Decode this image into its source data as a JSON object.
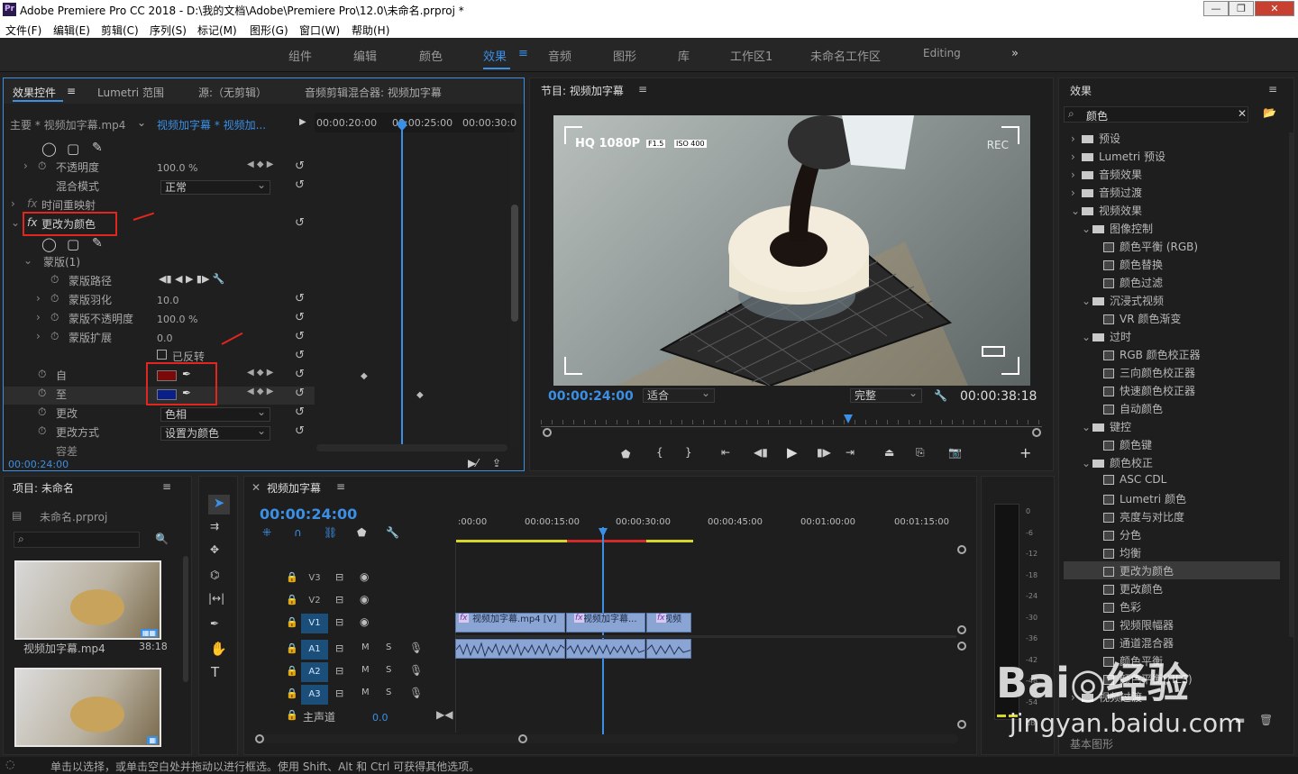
{
  "window": {
    "title": "Adobe Premiere Pro CC 2018 - D:\\我的文档\\Adobe\\Premiere Pro\\12.0\\未命名.prproj *"
  },
  "menu": [
    "文件(F)",
    "编辑(E)",
    "剪辑(C)",
    "序列(S)",
    "标记(M)",
    "图形(G)",
    "窗口(W)",
    "帮助(H)"
  ],
  "workspaces": [
    "组件",
    "编辑",
    "颜色",
    "效果",
    "音频",
    "图形",
    "库",
    "工作区1",
    "未命名工作区",
    "Editing"
  ],
  "effect_controls": {
    "tabs": [
      "效果控件",
      "Lumetri 范围",
      "源:（无剪辑）",
      "音频剪辑混合器: 视频加字幕"
    ],
    "master_clip": "主要 * 视频加字幕.mp4",
    "seq_clip": "视频加字幕 * 视频加...",
    "ruler": [
      "00:00:20:00",
      "00:00:25:00",
      "00:00:30:0"
    ],
    "opacity_label": "不透明度",
    "opacity_value": "100.0 %",
    "blend_label": "混合模式",
    "blend_value": "正常",
    "time_remap_label": "时间重映射",
    "effect_name": "更改为颜色",
    "mask_label": "蒙版(1)",
    "mask_path": "蒙版路径",
    "mask_feather": "蒙版羽化",
    "mask_feather_value": "10.0",
    "mask_opacity": "蒙版不透明度",
    "mask_opacity_value": "100.0 %",
    "mask_expand": "蒙版扩展",
    "mask_expand_value": "0.0",
    "inverted": "已反转",
    "from_label": "自",
    "from_color": "#7a0a0a",
    "to_label": "至",
    "to_color": "#0a1f8a",
    "change_label": "更改",
    "change_value": "色相",
    "change_by_label": "更改方式",
    "change_by_value": "设置为颜色",
    "tolerance_label": "容差",
    "timecode": "00:00:24:00"
  },
  "program": {
    "title": "节目: 视频加字幕",
    "timecode": "00:00:24:00",
    "fit": "适合",
    "quality": "完整",
    "duration": "00:00:38:18",
    "overlay_res": "HQ 1080P",
    "overlay_f": "F1.5",
    "overlay_iso": "ISO 400",
    "overlay_rec": "REC"
  },
  "project": {
    "title": "项目: 未命名",
    "file": "未命名.prproj",
    "clip_name": "视频加字幕.mp4",
    "clip_duration": "38:18"
  },
  "timeline": {
    "title": "视频加字幕",
    "timecode": "00:00:24:00",
    "ruler": [
      ":00:00",
      "00:00:15:00",
      "00:00:30:00",
      "00:00:45:00",
      "00:01:00:00",
      "00:01:15:00"
    ],
    "tracks": [
      "V3",
      "V2",
      "V1",
      "A1",
      "A2",
      "A3"
    ],
    "master": "主声道",
    "master_value": "0.0",
    "clip1": "视频加字幕.mp4 [V]",
    "clip2": "视频加字幕...",
    "clip3": "视频"
  },
  "effects": {
    "title": "效果",
    "search": "颜色",
    "items": [
      {
        "label": "预设",
        "lvl": 0,
        "kind": "folder",
        "open": false
      },
      {
        "label": "Lumetri 预设",
        "lvl": 0,
        "kind": "folder",
        "open": false
      },
      {
        "label": "音频效果",
        "lvl": 0,
        "kind": "folder",
        "open": false
      },
      {
        "label": "音频过渡",
        "lvl": 0,
        "kind": "folder",
        "open": false
      },
      {
        "label": "视频效果",
        "lvl": 0,
        "kind": "folder",
        "open": true
      },
      {
        "label": "图像控制",
        "lvl": 1,
        "kind": "folder",
        "open": true
      },
      {
        "label": "颜色平衡 (RGB)",
        "lvl": 2,
        "kind": "preset"
      },
      {
        "label": "颜色替换",
        "lvl": 2,
        "kind": "preset"
      },
      {
        "label": "颜色过滤",
        "lvl": 2,
        "kind": "preset"
      },
      {
        "label": "沉浸式视频",
        "lvl": 1,
        "kind": "folder",
        "open": true
      },
      {
        "label": "VR 颜色渐变",
        "lvl": 2,
        "kind": "preset"
      },
      {
        "label": "过时",
        "lvl": 1,
        "kind": "folder",
        "open": true
      },
      {
        "label": "RGB 颜色校正器",
        "lvl": 2,
        "kind": "preset"
      },
      {
        "label": "三向颜色校正器",
        "lvl": 2,
        "kind": "preset"
      },
      {
        "label": "快速颜色校正器",
        "lvl": 2,
        "kind": "preset"
      },
      {
        "label": "自动颜色",
        "lvl": 2,
        "kind": "preset"
      },
      {
        "label": "键控",
        "lvl": 1,
        "kind": "folder",
        "open": true
      },
      {
        "label": "颜色键",
        "lvl": 2,
        "kind": "preset"
      },
      {
        "label": "颜色校正",
        "lvl": 1,
        "kind": "folder",
        "open": true
      },
      {
        "label": "ASC CDL",
        "lvl": 2,
        "kind": "preset"
      },
      {
        "label": "Lumetri 颜色",
        "lvl": 2,
        "kind": "preset"
      },
      {
        "label": "亮度与对比度",
        "lvl": 2,
        "kind": "preset"
      },
      {
        "label": "分色",
        "lvl": 2,
        "kind": "preset"
      },
      {
        "label": "均衡",
        "lvl": 2,
        "kind": "preset"
      },
      {
        "label": "更改为颜色",
        "lvl": 2,
        "kind": "preset",
        "selected": true
      },
      {
        "label": "更改颜色",
        "lvl": 2,
        "kind": "preset"
      },
      {
        "label": "色彩",
        "lvl": 2,
        "kind": "preset"
      },
      {
        "label": "视频限幅器",
        "lvl": 2,
        "kind": "preset"
      },
      {
        "label": "通道混合器",
        "lvl": 2,
        "kind": "preset"
      },
      {
        "label": "颜色平衡",
        "lvl": 2,
        "kind": "preset"
      },
      {
        "label": "颜色平衡(HLS)",
        "lvl": 2,
        "kind": "preset"
      },
      {
        "label": "视频过渡",
        "lvl": 0,
        "kind": "folder",
        "open": false
      }
    ],
    "footer": "基本图形"
  },
  "meter": {
    "labels": [
      "0",
      "-6",
      "-12",
      "-18",
      "-24",
      "-30",
      "-36",
      "-42",
      "-48",
      "-54",
      "dB"
    ]
  },
  "status": {
    "text": "单击以选择，或单击空白处并拖动以进行框选。使用 Shift、Alt 和 Ctrl 可获得其他选项。"
  },
  "watermark": {
    "line1": "Bai◎经验",
    "line2": "jingyan.baidu.com"
  }
}
